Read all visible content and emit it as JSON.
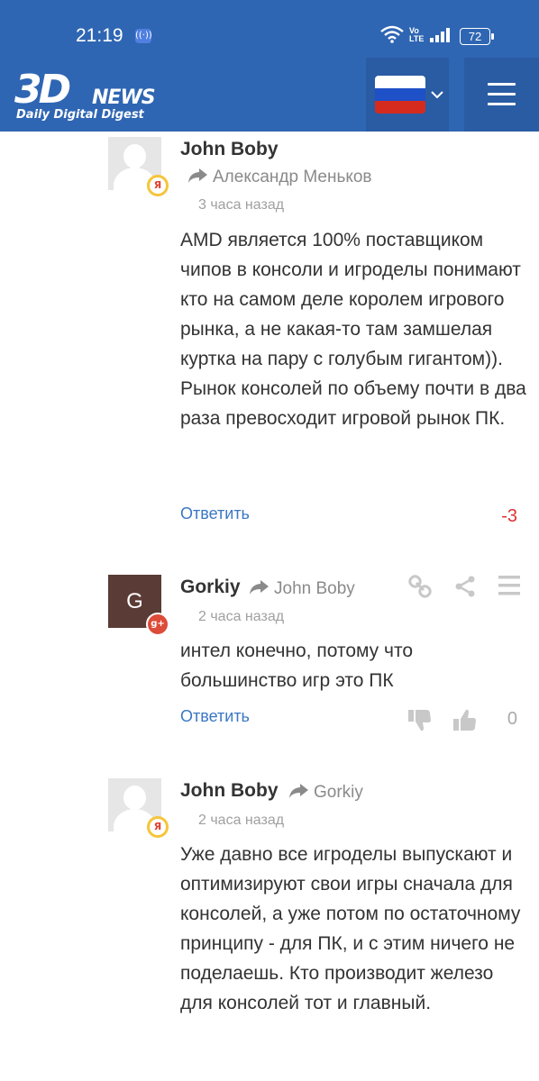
{
  "status_bar": {
    "time": "21:19",
    "battery": "72",
    "volte_top": "Vo",
    "volte_bottom": "LTE"
  },
  "header": {
    "logo_main": "3D",
    "logo_news": "NEWS",
    "logo_subtitle": "Daily Digital Digest",
    "language_flag": "russia-flag-icon",
    "brand_color": "#2f66b3"
  },
  "comments": [
    {
      "author": "John Boby",
      "reply_to": "Александр Меньков",
      "time": "3 часа назад",
      "text": "AMD является 100% поставщиком чипов в консоли и игроделы понимают кто на самом деле королем игрового рынка, а не какая-то там замшелая куртка на пару с голубым гигантом)). Рынок консолей по объему почти в два раза превосходит игровой рынок ПК.",
      "reply_label": "Ответить",
      "score": "-3",
      "badge": "yandex-badge"
    },
    {
      "author": "Gorkiy",
      "avatar_letter": "G",
      "reply_to": "John Boby",
      "time": "2 часа назад",
      "text": "интел конечно, потому что большинство игр это ПК",
      "reply_label": "Ответить",
      "score": "0",
      "badge": "google-plus-badge",
      "badge_text": "g+"
    },
    {
      "author": "John Boby",
      "reply_to": "Gorkiy",
      "time": "2 часа назад",
      "text": "Уже давно все игроделы выпускают и оптимизируют свои игры сначала для консолей, а уже потом по остаточному принципу - для ПК, и с этим ничего не поделаешь. Кто производит железо для консолей тот и главный.",
      "badge": "yandex-badge"
    }
  ],
  "badge_ya_text": "Я"
}
